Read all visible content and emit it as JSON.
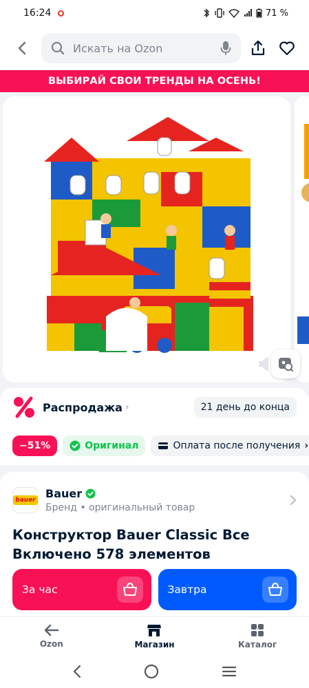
{
  "status_bar": {
    "time": "16:24",
    "battery": "71 %"
  },
  "search": {
    "placeholder": "Искать на Ozon"
  },
  "promo_banner": {
    "text": "ВЫБИРАЙ СВОИ ТРЕНДЫ НА ОСЕНЬ!"
  },
  "colors": {
    "accent_red": "#f91155",
    "accent_blue": "#005bff",
    "original_green": "#10c44c"
  },
  "sale": {
    "label": "Распродажа",
    "countdown": "21 день до конца"
  },
  "badges": {
    "discount": "−51%",
    "original": "Оригинал",
    "payment": "Оплата после получения"
  },
  "brand": {
    "name": "Bauer",
    "logo_text": "bauer",
    "subtitle": "Бренд • оригинальный товар"
  },
  "product": {
    "title": "Конструктор Bauer Classic Все Включено 578 элементов"
  },
  "cta": {
    "express_label": "За час",
    "tomorrow_label": "Завтра"
  },
  "bottom_nav": {
    "items": [
      {
        "label": "Ozon",
        "icon": "arrow-left-icon"
      },
      {
        "label": "Магазин",
        "icon": "store-icon"
      },
      {
        "label": "Каталог",
        "icon": "grid-icon"
      }
    ],
    "active_index": 1
  }
}
